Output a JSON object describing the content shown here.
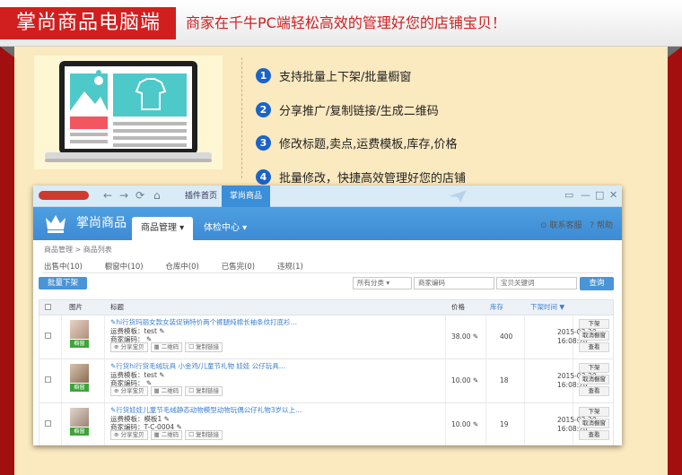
{
  "banner": {
    "brand": "掌尚商品电脑端",
    "tagline": "商家在千牛PC端轻松高效的管理好您的店铺宝贝！"
  },
  "features": [
    {
      "num": "1",
      "text": "支持批量上下架/批量橱窗"
    },
    {
      "num": "2",
      "text": "分享推广/复制链接/生成二维码"
    },
    {
      "num": "3",
      "text": "修改标题,卖点,运费模板,库存,价格"
    },
    {
      "num": "4",
      "text": "批量修改，快捷高效管理好您的店铺"
    }
  ],
  "window": {
    "tabs": [
      "插件首页",
      "掌尚商品"
    ],
    "app_title": "掌尚商品",
    "app_tabs": [
      "商品管理 ▾",
      "体检中心 ▾"
    ],
    "links": [
      "联系客服",
      "帮助"
    ],
    "breadcrumb": "商品管理 > 商品列表",
    "status_tabs": [
      "出售中(10)",
      "橱窗中(10)",
      "仓库中(0)",
      "已售完(0)",
      "违规(1)"
    ],
    "batch_button": "批量下架",
    "filters": {
      "category": "所有分类",
      "code": "商家编码",
      "keyword": "宝贝关键词"
    },
    "query_button": "查询",
    "columns": [
      "图片",
      "标题",
      "价格",
      "库存",
      "下架时间 ▼"
    ],
    "rows": [
      {
        "tag": "橱窗",
        "title": "✎hi行货玛丽女款女装促销特价两个裤腿纯棉长袖条纹打底衫…",
        "line1": "运费模板：test ✎",
        "line2": "商家编码： ✎",
        "price": "38.00 ✎",
        "stock": "400",
        "date": "2015-03-20",
        "time": "16:08:20"
      },
      {
        "tag": "橱窗",
        "title": "✎行货hi行货毛绒玩具 小金鸡/儿童节礼物 娃娃 公仔玩具…",
        "line1": "运费模板：test ✎",
        "line2": "商家编码： ✎",
        "price": "10.00 ✎",
        "stock": "18",
        "date": "2015-03-20",
        "time": "16:08:20"
      },
      {
        "tag": "橱窗",
        "title": "✎行货娃娃儿童节毛绒静态动物模型动物玩偶公仔礼物3岁以上…",
        "line1": "运费模板：模板1 ✎",
        "line2": "商家编码：T-C-0004 ✎",
        "price": "10.00 ✎",
        "stock": "19",
        "date": "2015-03-20",
        "time": "16:08:20"
      }
    ],
    "row_buttons": [
      "⊕ 分享宝贝",
      "▦ 二维码",
      "☐ 复制链接"
    ],
    "row_ops": [
      "下架",
      "取消橱窗",
      "查看"
    ]
  },
  "colors": {
    "background": "#a20f0f",
    "brand_red": "#d11f1f",
    "accent_blue": "#3d8bd4",
    "panel": "#fbe9bf"
  }
}
